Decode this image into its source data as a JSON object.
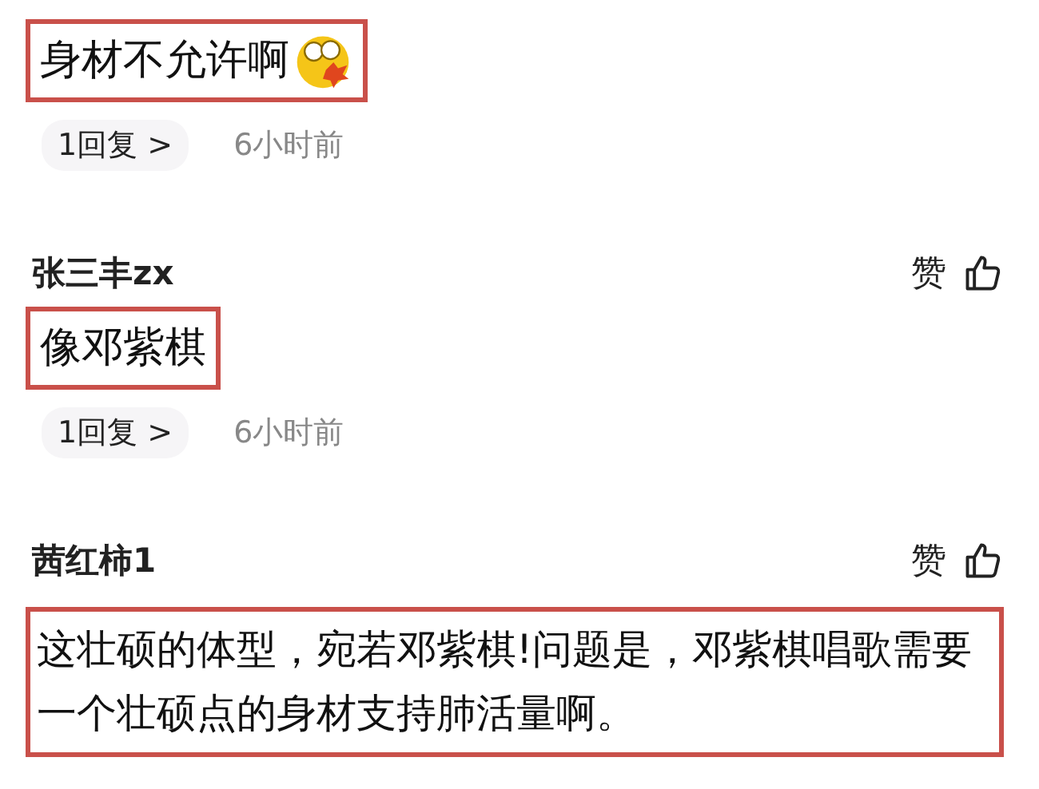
{
  "comments": [
    {
      "text": "身材不允许啊",
      "emoji": true,
      "highlighted": true,
      "replies": "1回复 >",
      "time": "6小时前"
    },
    {
      "author": "张三丰zx",
      "text": "像邓紫棋",
      "highlighted": true,
      "replies": "1回复 >",
      "time": "6小时前",
      "like": "赞"
    },
    {
      "author": "茜红柿1",
      "text": "这壮硕的体型，宛若邓紫棋!问题是，邓紫棋唱歌需要一个壮硕点的身材支持肺活量啊。",
      "highlighted": true,
      "like": "赞"
    }
  ]
}
